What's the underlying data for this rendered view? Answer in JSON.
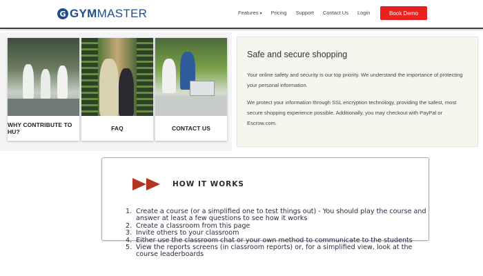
{
  "header": {
    "logo_mark": "G",
    "logo_text_bold": "GYM",
    "logo_text_rest": "MASTER",
    "nav": [
      "Features",
      "Pricing",
      "Support",
      "Contact Us",
      "Login"
    ],
    "cta": "Book Demo",
    "cta_color": "#e8201f"
  },
  "cards": [
    {
      "caption": "WHY CONTRIBUTE TO HU?"
    },
    {
      "caption": "FAQ"
    },
    {
      "caption": "CONTACT US"
    }
  ],
  "safe": {
    "title": "Safe and secure shopping",
    "p1": "Your online safety and security is our top priority. We understand the importance of protecting your personal information.",
    "p2": "We protect your information through SSL encryption technology, providing the safest, most secure shopping experience possible. Additionally, you may checkout with PayPal or Escrow.com."
  },
  "how": {
    "title": "HOW IT WORKS",
    "arrow_color": "#b3341f",
    "steps": [
      {
        "num": "1.",
        "text": "Create a course (or a simplified one to test things out) - You should play the course and answer at least a few questions to see how it works"
      },
      {
        "num": "2.",
        "text": "Create a classroom from this page"
      },
      {
        "num": "3.",
        "text": "Invite others to your classroom"
      },
      {
        "num": "4.",
        "text": "Either use the classroom chat or your own method to communicate to the students"
      },
      {
        "num": "5.",
        "text": "View the reports screens (in classroom reports) or, for a simplified view, look at the course leaderboards"
      }
    ]
  }
}
